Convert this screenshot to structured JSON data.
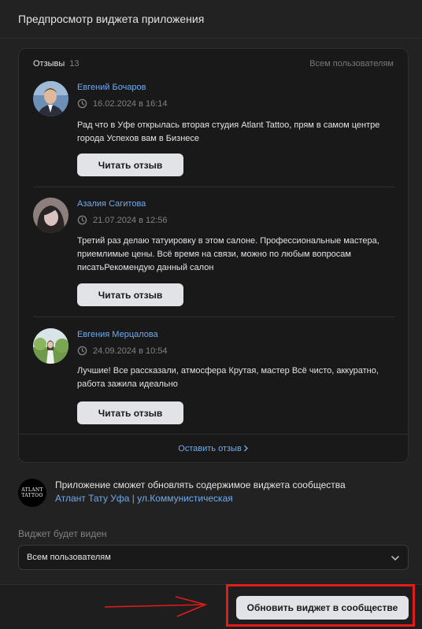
{
  "dialog": {
    "title": "Предпросмотр виджета приложения"
  },
  "widget": {
    "title": "Отзывы",
    "count": "13",
    "filter": "Всем пользователям",
    "reviews": [
      {
        "author": "Евгений Бочаров",
        "date": "16.02.2024 в 16:14",
        "text": "Рад что в Уфе открылась вторая студия Atlant Tattoo, прям в самом центре города Успехов вам в Бизнесе",
        "button": "Читать отзыв"
      },
      {
        "author": "Азалия Сагитова",
        "date": "21.07.2024 в 12:56",
        "text": "Третий раз делаю татуировку в этом салоне. Профессиональные мастера, приемлимые цены. Всё время на связи, можно по любым вопросам писатьРекомендую данный салон",
        "button": "Читать отзыв"
      },
      {
        "author": "Евгения Мерцалова",
        "date": "24.09.2024 в 10:54",
        "text": "Лучшие! Все рассказали, атмосфера Крутая, мастер Всё чисто, аккуратно, работа зажила идеально",
        "button": "Читать отзыв"
      }
    ],
    "leave_link": "Оставить отзыв"
  },
  "app": {
    "logo_line1": "ATLANT",
    "logo_line2": "TATTOO",
    "notice": "Приложение сможет обновлять содержимое виджета сообщества",
    "community": "Атлант Тату Уфа | ул.Коммунистическая"
  },
  "visibility": {
    "label": "Виджет будет виден",
    "selected": "Всем пользователям"
  },
  "footer": {
    "submit_label": "Обновить виджет в сообществе"
  },
  "colors": {
    "accent_link": "#71aaeb",
    "highlight": "#e41b1b",
    "button_bg": "#e1e3e6",
    "background": "#222223"
  },
  "icons": [
    "clock-icon",
    "chevron-down-icon",
    "chevron-right-icon",
    "arrow-annotation"
  ]
}
